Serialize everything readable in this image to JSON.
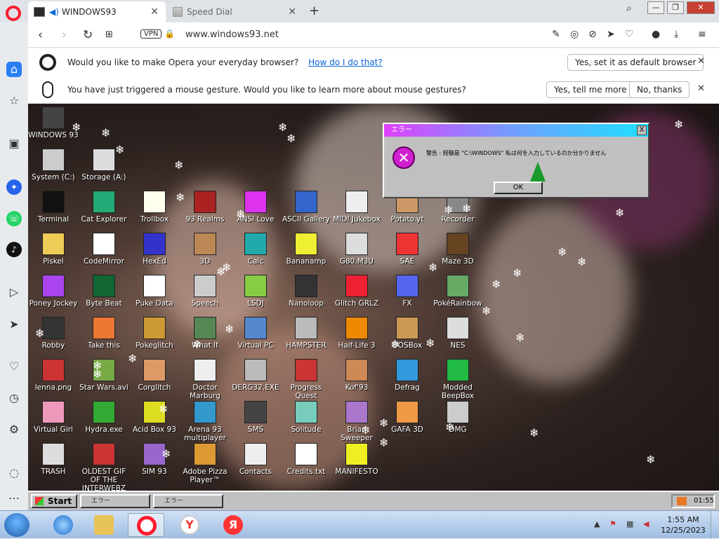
{
  "browser": {
    "tabs": [
      {
        "label": "WINDOWS93"
      },
      {
        "label": "Speed Dial"
      }
    ],
    "url": "www.windows93.net",
    "vpn_label": "VPN"
  },
  "notif_default": {
    "text": "Would you like to make Opera your everyday browser?",
    "link": "How do I do that?",
    "button": "Yes, set it as default browser"
  },
  "notif_gesture": {
    "text": "You have just triggered a mouse gesture. Would you like to learn more about mouse gestures?",
    "button_yes": "Yes, tell me more",
    "button_no": "No, thanks"
  },
  "desktop_icons": [
    {
      "label": "WINDOWS 93",
      "color": "#444"
    },
    {
      "label": "System (C:)",
      "color": "#ccc"
    },
    {
      "label": "Storage (A:)",
      "color": "#ddd"
    },
    {
      "label": "Terminal",
      "color": "#111"
    },
    {
      "label": "Cat Explorer",
      "color": "#2a7"
    },
    {
      "label": "Trollbox",
      "color": "#ffe"
    },
    {
      "label": "93 Realms",
      "color": "#a22"
    },
    {
      "label": "ANSI Love",
      "color": "#d3e"
    },
    {
      "label": "ASCII Gallery",
      "color": "#36c"
    },
    {
      "label": "MIDI Jukebox",
      "color": "#eee"
    },
    {
      "label": "Potato.yt",
      "color": "#c96"
    },
    {
      "label": "Recorder",
      "color": "#888"
    },
    {
      "label": "Piskel",
      "color": "#ec5"
    },
    {
      "label": "CodeMirror",
      "color": "#fff"
    },
    {
      "label": "HexEd",
      "color": "#33c"
    },
    {
      "label": "3D",
      "color": "#b85"
    },
    {
      "label": "Calc",
      "color": "#2aa"
    },
    {
      "label": "Bananamp",
      "color": "#ee3"
    },
    {
      "label": "G80.M3U",
      "color": "#ddd"
    },
    {
      "label": "SAE",
      "color": "#e33"
    },
    {
      "label": "Maze 3D",
      "color": "#642"
    },
    {
      "label": "Poney Jockey",
      "color": "#a4e"
    },
    {
      "label": "Byte Beat",
      "color": "#163"
    },
    {
      "label": "Puke Data",
      "color": "#fff"
    },
    {
      "label": "Speech",
      "color": "#ccc"
    },
    {
      "label": "LSDJ",
      "color": "#8c4"
    },
    {
      "label": "Nanoloop",
      "color": "#333"
    },
    {
      "label": "Glitch GRLZ",
      "color": "#e23"
    },
    {
      "label": "FX",
      "color": "#56e"
    },
    {
      "label": "PokéRainbow",
      "color": "#6a6"
    },
    {
      "label": "Robby",
      "color": "#333"
    },
    {
      "label": "Take this",
      "color": "#e73"
    },
    {
      "label": "Pokeglitch",
      "color": "#c93"
    },
    {
      "label": "What If",
      "color": "#585"
    },
    {
      "label": "Virtual PC",
      "color": "#58c"
    },
    {
      "label": "HAMPSTER",
      "color": "#bbb"
    },
    {
      "label": "Half-Life 3",
      "color": "#e80"
    },
    {
      "label": "DOSBox",
      "color": "#c95"
    },
    {
      "label": "NES",
      "color": "#ddd"
    },
    {
      "label": "lenna.png",
      "color": "#c33"
    },
    {
      "label": "Star Wars.avi",
      "color": "#7a4"
    },
    {
      "label": "Corglitch",
      "color": "#d96"
    },
    {
      "label": "Doctor Marburg",
      "color": "#eee"
    },
    {
      "label": "DERG32.EXE",
      "color": "#bbb"
    },
    {
      "label": "Progress Quest",
      "color": "#c33"
    },
    {
      "label": "Kof'93",
      "color": "#c85"
    },
    {
      "label": "Defrag",
      "color": "#39d"
    },
    {
      "label": "Modded BeepBox",
      "color": "#2b4"
    },
    {
      "label": "Virtual Girl",
      "color": "#e9b"
    },
    {
      "label": "Hydra.exe",
      "color": "#3a3"
    },
    {
      "label": "Acid Box 93",
      "color": "#dd2"
    },
    {
      "label": "Arena 93 multiplayer",
      "color": "#39c"
    },
    {
      "label": "SMS",
      "color": "#444"
    },
    {
      "label": "Solitude",
      "color": "#7cb"
    },
    {
      "label": "Brian Sweeper",
      "color": "#a7c"
    },
    {
      "label": "GAFA 3D",
      "color": "#e94"
    },
    {
      "label": "DMG",
      "color": "#ccc"
    },
    {
      "label": "TRASH",
      "color": "#ddd"
    },
    {
      "label": "OLDEST GIF OF THE INTERWEBZ",
      "color": "#c33"
    },
    {
      "label": "SIM 93",
      "color": "#96c"
    },
    {
      "label": "Adobe Pizza Player™",
      "color": "#d93"
    },
    {
      "label": "Contacts",
      "color": "#eee"
    },
    {
      "label": "Credits.txt",
      "color": "#fff"
    },
    {
      "label": "MANIFESTO",
      "color": "#ee2"
    }
  ],
  "error_dialog": {
    "title": "エラー",
    "message": "警告 : 経験是 \"C:\\WINDOWS\" 私は何を入力しているのか分かりません",
    "ok": "OK",
    "close": "X"
  },
  "w93_taskbar": {
    "start": "Start",
    "tasks": [
      "エラー",
      "エラー"
    ],
    "time": "01:55"
  },
  "win7_taskbar": {
    "time": "1:55 AM",
    "date": "12/25/2023"
  }
}
